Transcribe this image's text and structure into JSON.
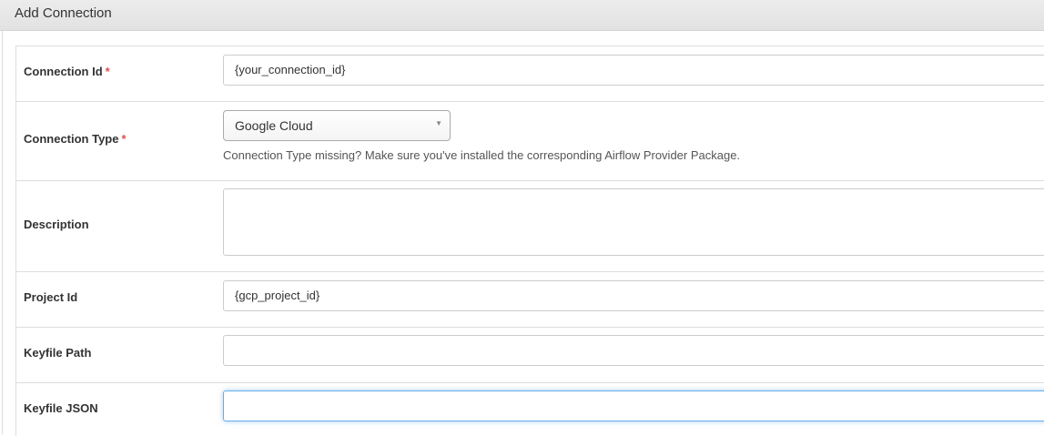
{
  "panel": {
    "title": "Add Connection"
  },
  "form": {
    "required_mark": "*",
    "connection_id": {
      "label": "Connection Id",
      "value": "{your_connection_id}"
    },
    "connection_type": {
      "label": "Connection Type",
      "selected": "Google Cloud",
      "arrow": "▼",
      "help": "Connection Type missing? Make sure you've installed the corresponding Airflow Provider Package."
    },
    "description": {
      "label": "Description",
      "value": ""
    },
    "project_id": {
      "label": "Project Id",
      "value": "{gcp_project_id}"
    },
    "keyfile_path": {
      "label": "Keyfile Path",
      "value": ""
    },
    "keyfile_json": {
      "label": "Keyfile JSON",
      "value": ""
    }
  },
  "colors": {
    "required": "#d9534f",
    "focus_border": "#66afe9",
    "header_bg": "#e6e6e6"
  }
}
